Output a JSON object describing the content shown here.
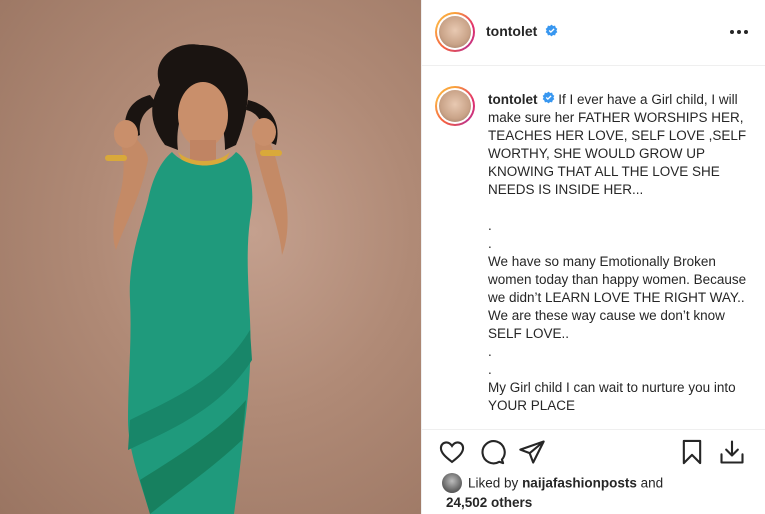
{
  "post": {
    "username": "tontolet",
    "verified": true,
    "caption_text": "If I ever have a Girl child, I will make sure her FATHER WORSHIPS HER, TEACHES HER LOVE, SELF LOVE ,SELF WORTHY, SHE WOULD GROW UP KNOWING THAT ALL THE LOVE SHE NEEDS IS INSIDE HER...\n\n.\n.\nWe have so many Emotionally Broken women today than happy women. Because we didn’t LEARN LOVE THE RIGHT WAY..\nWe are these way cause we don’t know SELF LOVE..\n.\n.\nMy Girl child I can wait to nurture you into YOUR PLACE"
  },
  "likes": {
    "prefix": "Liked by",
    "liked_by_user": "naijafashionposts",
    "conjunction": "and",
    "others": "24,502 others"
  },
  "icons": {
    "header_avatar": "profile-avatar",
    "more": "more-options-icon",
    "verified": "verified-badge-icon",
    "like": "heart-icon",
    "comment": "comment-bubble-icon",
    "share": "paper-plane-icon",
    "save": "bookmark-icon",
    "download": "download-icon"
  },
  "colors": {
    "verified": "#3897f0",
    "dress": "#1f9a7c",
    "background_photo": "#b08a76",
    "text": "#262626",
    "divider": "#efefef"
  }
}
